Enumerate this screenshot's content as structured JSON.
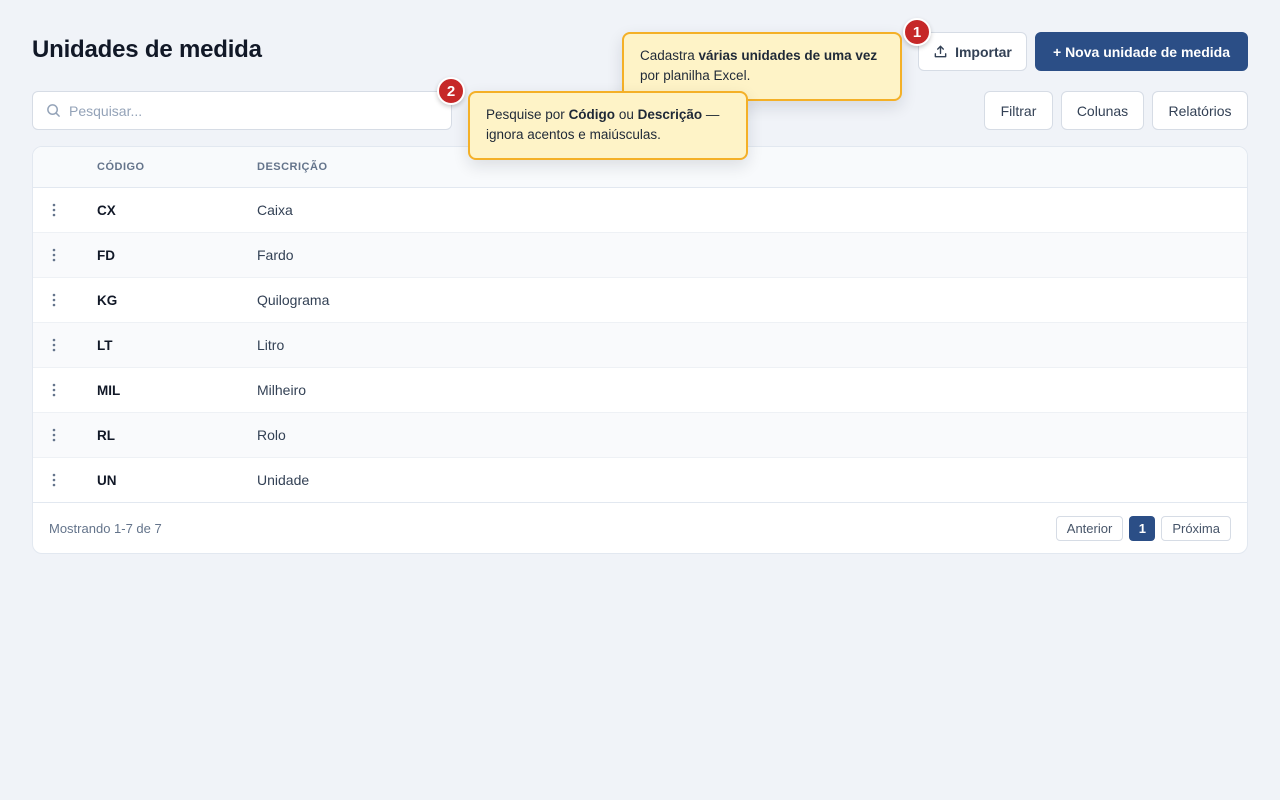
{
  "page": {
    "title": "Unidades de medida"
  },
  "toolbar": {
    "import_label": "Importar",
    "new_label": "+ Nova unidade de medida",
    "filter_label": "Filtrar",
    "columns_label": "Colunas",
    "reports_label": "Relatórios"
  },
  "search": {
    "placeholder": "Pesquisar...",
    "value": ""
  },
  "table": {
    "columns": [
      "CÓDIGO",
      "DESCRIÇÃO"
    ],
    "rows": [
      {
        "code": "CX",
        "description": "Caixa"
      },
      {
        "code": "FD",
        "description": "Fardo"
      },
      {
        "code": "KG",
        "description": "Quilograma"
      },
      {
        "code": "LT",
        "description": "Litro"
      },
      {
        "code": "MIL",
        "description": "Milheiro"
      },
      {
        "code": "RL",
        "description": "Rolo"
      },
      {
        "code": "UN",
        "description": "Unidade"
      }
    ]
  },
  "footer": {
    "showing": "Mostrando 1-7 de 7",
    "prev_label": "Anterior",
    "current_page": "1",
    "next_label": "Próxima"
  },
  "tips": [
    {
      "number": "1",
      "parts": [
        {
          "text": "Cadastra ",
          "bold": false
        },
        {
          "text": "várias unidades de uma vez",
          "bold": true
        },
        {
          "text": " por planilha Excel.",
          "bold": false
        }
      ]
    },
    {
      "number": "2",
      "parts": [
        {
          "text": "Pesquise por ",
          "bold": false
        },
        {
          "text": "Código",
          "bold": true
        },
        {
          "text": " ou ",
          "bold": false
        },
        {
          "text": "Descrição",
          "bold": true
        },
        {
          "text": " — ignora acentos e maiúsculas.",
          "bold": false
        }
      ]
    }
  ],
  "colors": {
    "primary": "#2b4e86",
    "tip_bg": "#fef3c7",
    "tip_border": "#f4b027",
    "badge": "#c62828",
    "page_bg": "#f0f3f8"
  },
  "icons": {
    "import": "upload-icon",
    "search": "search-icon",
    "row_menu": "kebab-menu-icon"
  }
}
